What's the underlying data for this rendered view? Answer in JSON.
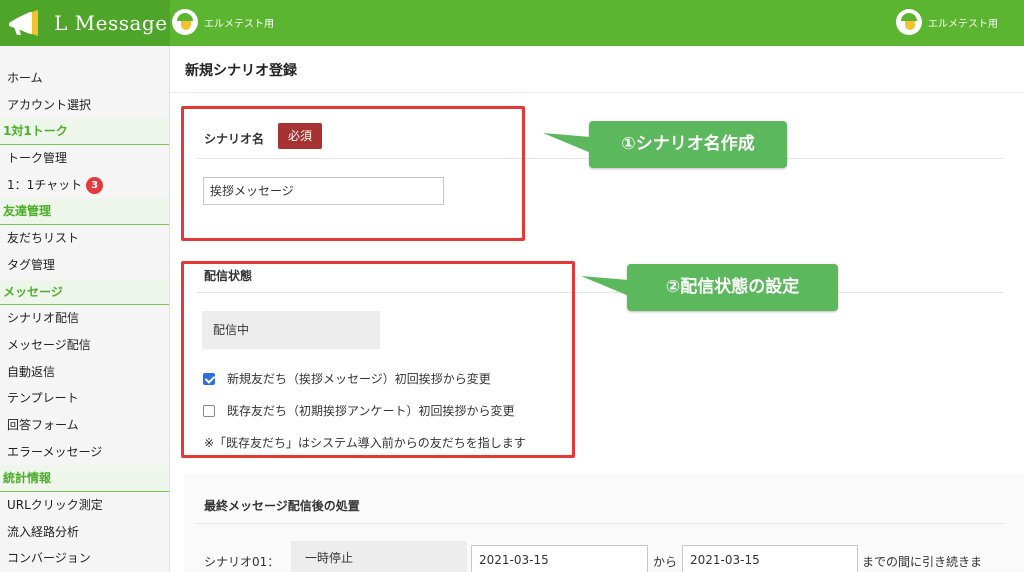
{
  "brand": {
    "name": "L Message"
  },
  "header": {
    "account_left": "エルメテスト用",
    "account_right": "エルメテスト用"
  },
  "sidebar": {
    "items": [
      {
        "type": "item",
        "label": "ホーム"
      },
      {
        "type": "item",
        "label": "アカウント選択"
      },
      {
        "type": "head",
        "label": "1対1トーク"
      },
      {
        "type": "item",
        "label": "トーク管理"
      },
      {
        "type": "item",
        "label": "1：1チャット",
        "badge": "3"
      },
      {
        "type": "head",
        "label": "友達管理"
      },
      {
        "type": "item",
        "label": "友だちリスト"
      },
      {
        "type": "item",
        "label": "タグ管理"
      },
      {
        "type": "head",
        "label": "メッセージ"
      },
      {
        "type": "item",
        "label": "シナリオ配信"
      },
      {
        "type": "item",
        "label": "メッセージ配信"
      },
      {
        "type": "item",
        "label": "自動返信"
      },
      {
        "type": "item",
        "label": "テンプレート"
      },
      {
        "type": "item",
        "label": "回答フォーム"
      },
      {
        "type": "item",
        "label": "エラーメッセージ"
      },
      {
        "type": "head",
        "label": "統計情報"
      },
      {
        "type": "item",
        "label": "URLクリック測定"
      },
      {
        "type": "item",
        "label": "流入経路分析"
      },
      {
        "type": "item",
        "label": "コンバージョン"
      }
    ]
  },
  "main": {
    "title": "新規シナリオ登録",
    "scenario_name": {
      "label": "シナリオ名",
      "required": "必須",
      "value": "挨拶メッセージ"
    },
    "delivery": {
      "label": "配信状態",
      "status": "配信中",
      "options": [
        {
          "label": "新規友だち（挨拶メッセージ）初回挨拶から変更",
          "checked": true
        },
        {
          "label": "既存友だち（初期挨拶アンケート）初回挨拶から変更",
          "checked": false
        }
      ],
      "note": "※「既存友だち」はシステム導入前からの友だちを指します"
    },
    "after": {
      "label": "最終メッセージ配信後の処置",
      "row_label": "シナリオ01：",
      "action": "一時停止",
      "date_from": "2021-03-15",
      "from_text": "から",
      "date_to": "2021-03-15",
      "tail_text": "までの間に引き続きま"
    }
  },
  "annotations": {
    "callout1": "①シナリオ名作成",
    "callout2": "②配信状態の設定",
    "highlight_color": "#e53935",
    "callout_color": "#5cb85c"
  },
  "colors": {
    "header": "#5cb531",
    "brand": "#4fa52a",
    "section_head": "#4caf2a",
    "required": "#a63232",
    "badge": "#e23b3b"
  }
}
